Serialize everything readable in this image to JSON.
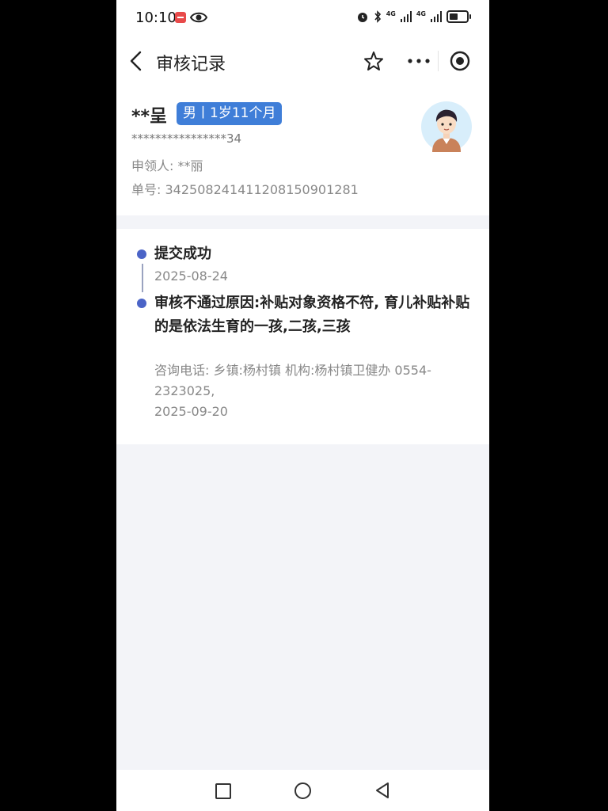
{
  "status_bar": {
    "time": "10:10",
    "network_1": "4G",
    "network_2": "4G"
  },
  "nav": {
    "title": "审核记录",
    "icons": [
      "back-icon",
      "star-icon",
      "more-icon",
      "target-icon"
    ]
  },
  "profile": {
    "name": "**呈",
    "badge": "男丨1岁11个月",
    "id_masked": "****************34",
    "applicant_label": "申领人:",
    "applicant_value": "**丽",
    "order_label": "单号:",
    "order_value": "342508241411208150901281"
  },
  "timeline": [
    {
      "title": "提交成功",
      "date": "2025-08-24"
    },
    {
      "title": "审核不通过原因:补贴对象资格不符, 育儿补贴补贴的是依法生育的一孩,二孩,三孩",
      "contact": "咨询电话: 乡镇:杨村镇 机构:杨村镇卫健办 0554-2323025,",
      "date": "2025-09-20"
    }
  ],
  "colors": {
    "accent": "#3f7ed8",
    "timeline_dot": "#4b64c7",
    "page_bg": "#f3f4f8"
  }
}
